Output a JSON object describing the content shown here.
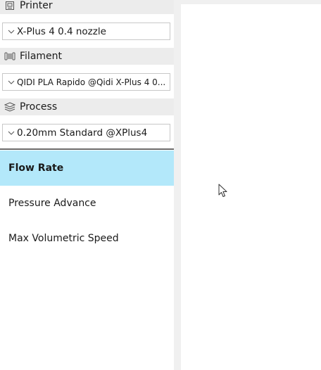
{
  "sidebar": {
    "printer": {
      "header": "Printer",
      "icon": "printer-icon",
      "selected": "X-Plus 4 0.4 nozzle"
    },
    "filament": {
      "header": "Filament",
      "icon": "filament-spool-icon",
      "selected": "QIDI PLA Rapido @Qidi X-Plus 4 0..."
    },
    "process": {
      "header": "Process",
      "icon": "layers-icon",
      "selected": "0.20mm Standard @XPlus4"
    },
    "calibration_items": [
      {
        "label": "Flow Rate",
        "active": true
      },
      {
        "label": "Pressure Advance",
        "active": false
      },
      {
        "label": "Max Volumetric Speed",
        "active": false
      }
    ]
  },
  "colors": {
    "active_item_bg": "#b3e8fa",
    "header_bg": "#ececec",
    "window_bg": "#f0f0f0"
  }
}
